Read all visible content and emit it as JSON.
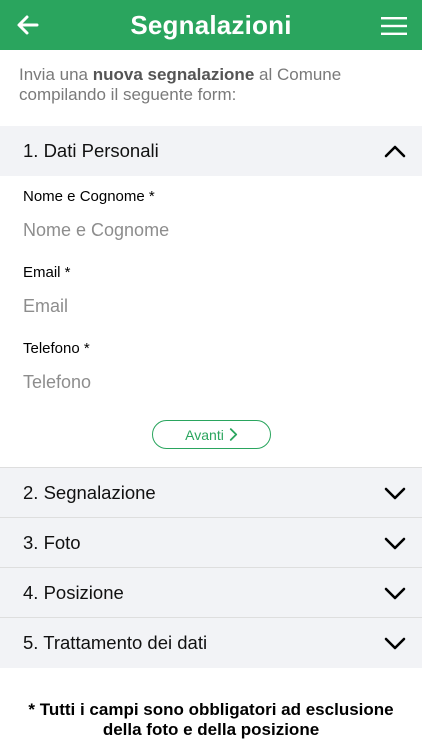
{
  "header": {
    "title": "Segnalazioni"
  },
  "intro": {
    "prefix": "Invia una ",
    "bold": "nuova segnalazione",
    "suffix": " al Comune compilando il seguente form:"
  },
  "sections": [
    {
      "title": "1. Dati Personali",
      "expanded": true
    },
    {
      "title": "2. Segnalazione",
      "expanded": false
    },
    {
      "title": "3. Foto",
      "expanded": false
    },
    {
      "title": "4. Posizione",
      "expanded": false
    },
    {
      "title": "5. Trattamento dei dati",
      "expanded": false
    }
  ],
  "form": {
    "name_label": "Nome e Cognome *",
    "name_placeholder": "Nome e Cognome",
    "email_label": "Email *",
    "email_placeholder": "Email",
    "phone_label": "Telefono *",
    "phone_placeholder": "Telefono",
    "next_button": "Avanti"
  },
  "footer": {
    "note": "* Tutti i campi sono obbligatori ad esclusione della foto e della posizione"
  },
  "colors": {
    "brand": "#2aa55e",
    "section_bg": "#f2f3f6"
  },
  "icons": {
    "back": "arrow-left-icon",
    "menu": "hamburger-menu-icon",
    "expanded": "chevron-up-icon",
    "collapsed": "chevron-down-icon",
    "next": "chevron-right-icon"
  }
}
